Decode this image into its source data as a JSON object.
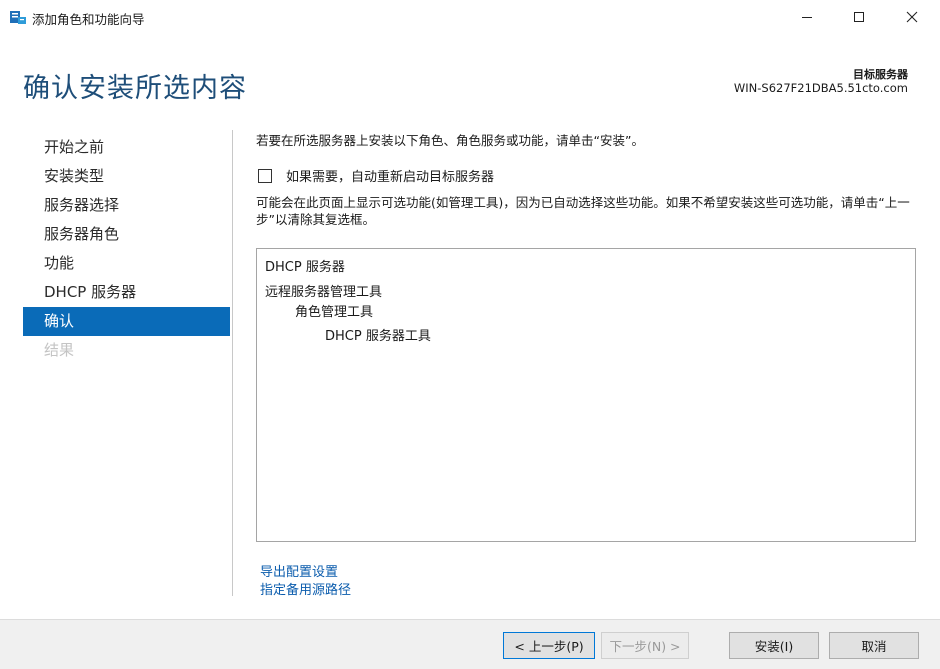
{
  "window": {
    "title": "添加角色和功能向导",
    "icons": {
      "app": "server-manager-icon",
      "minimize": "minimize-icon",
      "maximize": "maximize-icon",
      "close": "close-icon"
    }
  },
  "header": {
    "page_title": "确认安装所选内容",
    "target_label": "目标服务器",
    "target_server": "WIN-S627F21DBA5.51cto.com"
  },
  "sidebar": {
    "items": [
      {
        "label": "开始之前",
        "state": "normal"
      },
      {
        "label": "安装类型",
        "state": "normal"
      },
      {
        "label": "服务器选择",
        "state": "normal"
      },
      {
        "label": "服务器角色",
        "state": "normal"
      },
      {
        "label": "功能",
        "state": "normal"
      },
      {
        "label": "DHCP 服务器",
        "state": "normal"
      },
      {
        "label": "确认",
        "state": "active"
      },
      {
        "label": "结果",
        "state": "disabled"
      }
    ]
  },
  "main": {
    "intro": "若要在所选服务器上安装以下角色、角色服务或功能，请单击“安装”。",
    "restart_checkbox": {
      "label": "如果需要，自动重新启动目标服务器",
      "checked": false
    },
    "note": "可能会在此页面上显示可选功能(如管理工具)，因为已自动选择这些功能。如果不希望安装这些可选功能，请单击“上一步”以清除其复选框。",
    "selections": [
      {
        "label": "DHCP 服务器",
        "level": 0
      },
      {
        "label": "远程服务器管理工具",
        "level": 0
      },
      {
        "label": "角色管理工具",
        "level": 1
      },
      {
        "label": "DHCP 服务器工具",
        "level": 2
      }
    ],
    "links": {
      "export": "导出配置设置",
      "source": "指定备用源路径"
    }
  },
  "footer": {
    "prev": "< 上一步(P)",
    "next": "下一步(N) >",
    "install": "安装(I)",
    "cancel": "取消"
  },
  "colors": {
    "accent": "#0a6bb8",
    "title": "#1e4e79",
    "link": "#0b5cad"
  }
}
